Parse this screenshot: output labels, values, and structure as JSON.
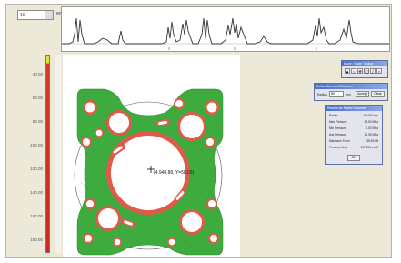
{
  "toolbar": {
    "combo_value": "10",
    "zoom_label": "80%"
  },
  "ruler": {
    "ticks": [
      "40.00",
      "60.00",
      "80.00",
      "100.00",
      "120.00",
      "140.00",
      "160.00",
      "180.00"
    ]
  },
  "overlay": {
    "coordinate": "(4.948,88, Y=58.09)"
  },
  "colors": {
    "background": "#ece9d8",
    "part_fill": "#3dab3d",
    "outline": "#e05a4a",
    "colorbar_top": "#e8e030",
    "colorbar_bottom": "#cc2a20",
    "dialog_title": "#4b6fd0"
  },
  "tools_dialog": {
    "title": "Move / Scale Toolbar",
    "buttons": [
      "arrow-icon",
      "zoom-icon",
      "pan-icon",
      "circle-icon",
      "line-icon",
      "close-icon"
    ]
  },
  "define_dialog": {
    "title": "Define Selected Diameter",
    "label": "Radius",
    "value": "80",
    "unit": "mm",
    "button_primary": "Accept",
    "button_secondary": "Clear"
  },
  "results_dialog": {
    "title": "Results for Radial Diameter",
    "rows": [
      {
        "label": "Radius",
        "value": "80.000 mm"
      },
      {
        "label": "Max Pressure",
        "value": "28.00 MPa"
      },
      {
        "label": "Min Pressure",
        "value": "0.00 MPa"
      },
      {
        "label": "Ave Pressure",
        "value": "10.05 MPa"
      },
      {
        "label": "Maximum Force",
        "value": "35.69 kN"
      },
      {
        "label": "Pressure Area",
        "value": "107.514 mm2"
      }
    ],
    "ok_label": "OK"
  }
}
